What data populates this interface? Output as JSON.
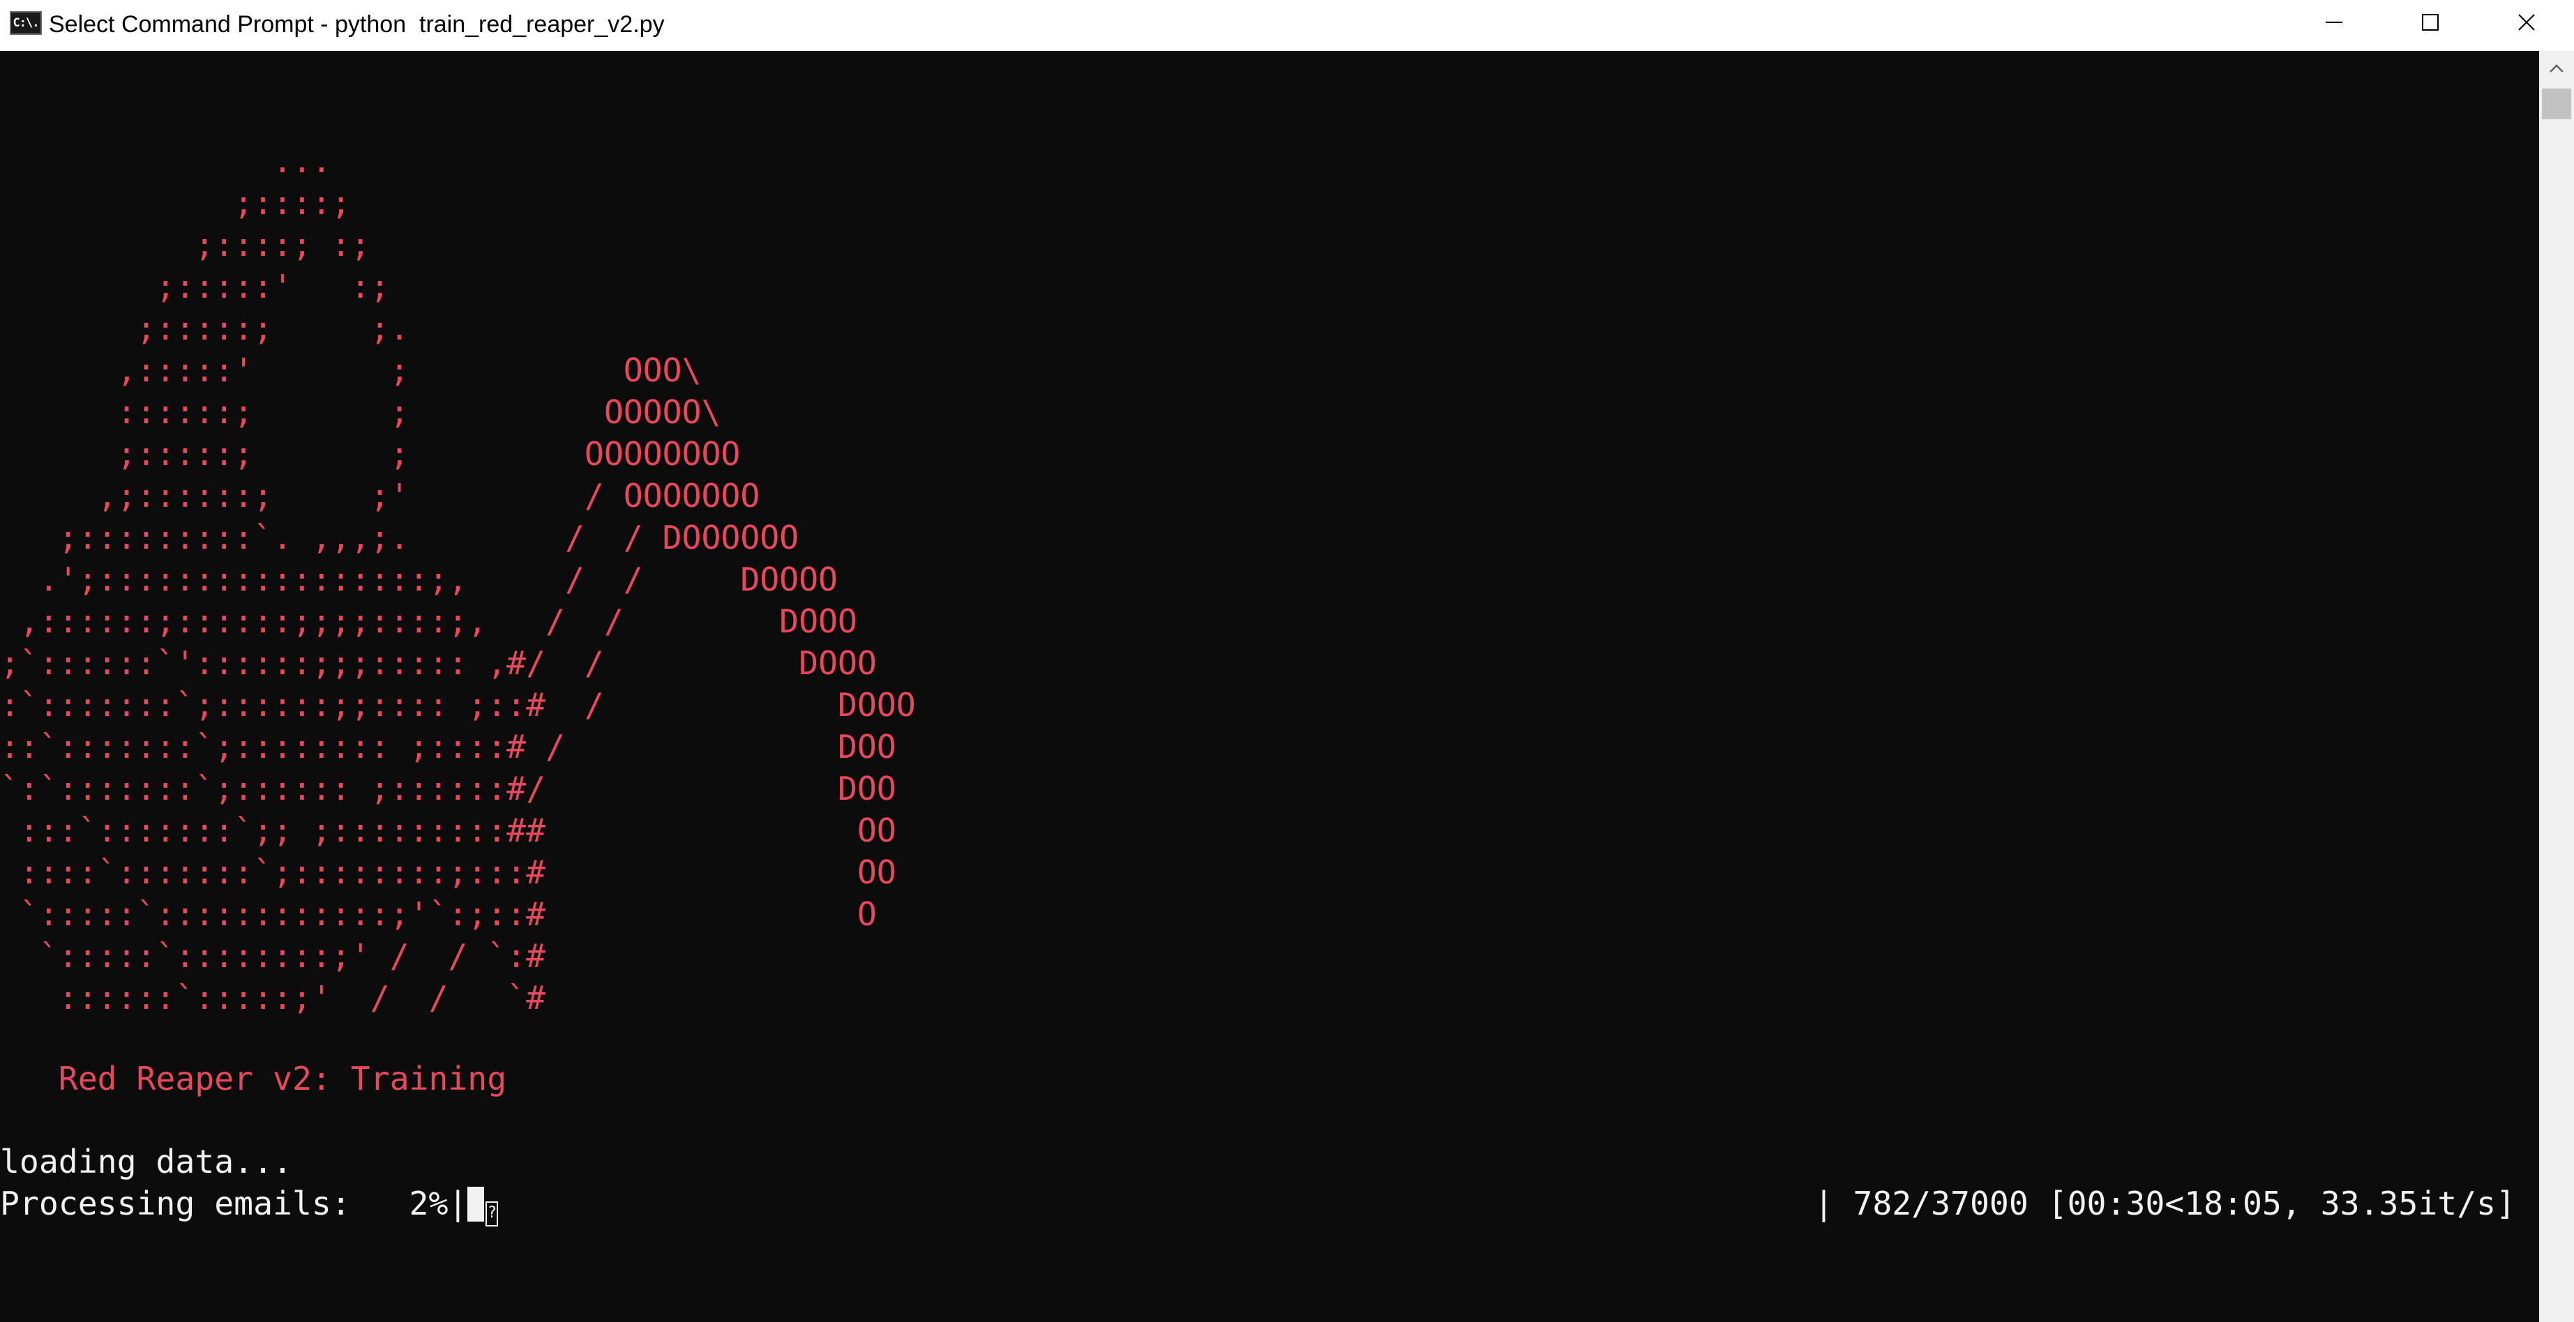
{
  "window": {
    "title": "Select Command Prompt - python  train_red_reaper_v2.py",
    "icon_text": "C:\\.",
    "icon": "command-prompt-icon",
    "controls": [
      "minimize-icon",
      "maximize-icon",
      "close-icon"
    ]
  },
  "console": {
    "colors": {
      "background": "#0c0c0c",
      "text": "#f2f2f2",
      "accent": "#e7485b"
    },
    "ascii_art": "              ...\n            ;::::;\n          ;::::; :;\n        ;:::::'   :;\n       ;:::::;     ;.\n      ,:::::'       ;           OOO\\\n      ::::::;       ;          OOOOO\\\n      ;:::::;       ;         OOOOOOOO\n     ,;::::::;     ;'         / OOOOOOO\n   ;:::::::::`. ,,,;.        /  / DOOOOOO\n  .';:::::::::::::::::;,     /  /     DOOOO\n ,::::::;::::::;;;;::::;,   /  /        DOOO\n;`::::::`'::::::;;;::::: ,#/  /          DOOO\n:`:::::::`;::::::;;:::: ;::#  /            DOOO\n::`:::::::`;:::::::: ;::::# /              DOO\n`:`:::::::`;:::::: ;::::::#/               DOO\n :::`:::::::`;; ;:::::::::##                OO\n ::::`:::::::`;::::::::;:::#                OO\n `:::::`::::::::::::;'`:;::#                O\n  `:::::`::::::::;' /  / `:#\n   ::::::`:::::;'  /  /   `#",
    "training_title": "   Red Reaper v2: Training",
    "loading_line": "loading data...",
    "progress": {
      "label": "Processing emails:",
      "percent_text": "2%",
      "fraction": 0.02,
      "stats": "| 782/37000 [00:30<18:05, 33.35it/s]",
      "missing_glyph": "?"
    }
  },
  "scrollbar": {
    "up_icon": "scroll-up-arrow-icon"
  }
}
